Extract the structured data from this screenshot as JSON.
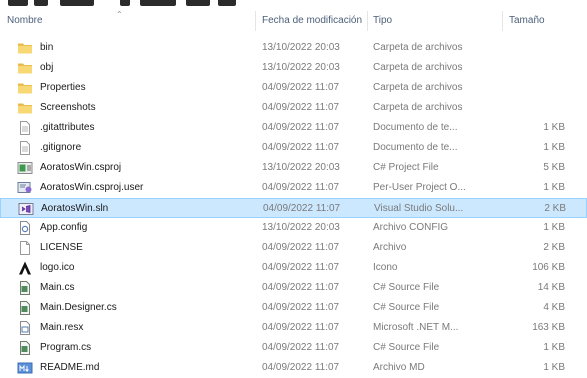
{
  "header": {
    "name": "Nombre",
    "date": "Fecha de modificación",
    "type": "Tipo",
    "size": "Tamaño"
  },
  "files": [
    {
      "name": "bin",
      "date": "13/10/2022 20:03",
      "type": "Carpeta de archivos",
      "size": "",
      "icon": "folder-icon"
    },
    {
      "name": "obj",
      "date": "13/10/2022 20:03",
      "type": "Carpeta de archivos",
      "size": "",
      "icon": "folder-icon"
    },
    {
      "name": "Properties",
      "date": "04/09/2022 11:07",
      "type": "Carpeta de archivos",
      "size": "",
      "icon": "folder-icon"
    },
    {
      "name": "Screenshots",
      "date": "04/09/2022 11:07",
      "type": "Carpeta de archivos",
      "size": "",
      "icon": "folder-icon"
    },
    {
      "name": ".gitattributes",
      "date": "04/09/2022 11:07",
      "type": "Documento de te...",
      "size": "1 KB",
      "icon": "text-file-icon"
    },
    {
      "name": ".gitignore",
      "date": "04/09/2022 11:07",
      "type": "Documento de te...",
      "size": "1 KB",
      "icon": "text-file-icon"
    },
    {
      "name": "AoratosWin.csproj",
      "date": "13/10/2022 20:03",
      "type": "C# Project File",
      "size": "5 KB",
      "icon": "csproj-icon"
    },
    {
      "name": "AoratosWin.csproj.user",
      "date": "04/09/2022 11:07",
      "type": "Per-User Project O...",
      "size": "1 KB",
      "icon": "user-project-icon"
    },
    {
      "name": "AoratosWin.sln",
      "date": "04/09/2022 11:07",
      "type": "Visual Studio Solu...",
      "size": "2 KB",
      "icon": "visual-studio-solution-icon",
      "selected": true
    },
    {
      "name": "App.config",
      "date": "13/10/2022 20:03",
      "type": "Archivo CONFIG",
      "size": "1 KB",
      "icon": "config-file-icon"
    },
    {
      "name": "LICENSE",
      "date": "04/09/2022 11:07",
      "type": "Archivo",
      "size": "2 KB",
      "icon": "blank-file-icon"
    },
    {
      "name": "logo.ico",
      "date": "04/09/2022 11:07",
      "type": "Icono",
      "size": "106 KB",
      "icon": "logo-ico-icon"
    },
    {
      "name": "Main.cs",
      "date": "04/09/2022 11:07",
      "type": "C# Source File",
      "size": "14 KB",
      "icon": "csharp-source-icon"
    },
    {
      "name": "Main.Designer.cs",
      "date": "04/09/2022 11:07",
      "type": "C# Source File",
      "size": "4 KB",
      "icon": "csharp-source-icon"
    },
    {
      "name": "Main.resx",
      "date": "04/09/2022 11:07",
      "type": "Microsoft .NET M...",
      "size": "163 KB",
      "icon": "resx-file-icon"
    },
    {
      "name": "Program.cs",
      "date": "04/09/2022 11:07",
      "type": "C# Source File",
      "size": "1 KB",
      "icon": "csharp-source-icon"
    },
    {
      "name": "README.md",
      "date": "04/09/2022 11:07",
      "type": "Archivo MD",
      "size": "1 KB",
      "icon": "markdown-file-icon"
    }
  ],
  "colors": {
    "selection_background": "#cce8ff",
    "selection_border": "#99d1ff",
    "folder": "#f8d775",
    "header_text": "#4c607a"
  }
}
